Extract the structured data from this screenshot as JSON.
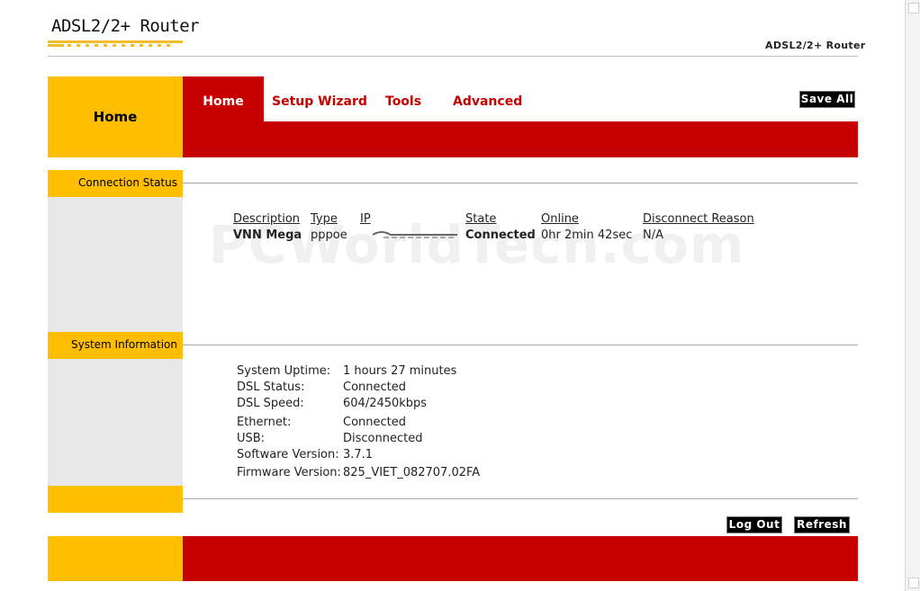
{
  "header": {
    "logo_text": "ADSL2/2+ Router",
    "product_name": "ADSL2/2+ Router"
  },
  "nav": {
    "section_title": "Home",
    "tabs": [
      "Home",
      "Setup Wizard",
      "Tools",
      "Advanced"
    ],
    "active_tab": "Home",
    "save_all_label": "Save All"
  },
  "sidebar": {
    "connection_status_label": "Connection Status",
    "system_information_label": "System Information"
  },
  "connection_status": {
    "columns": [
      "Description",
      "Type",
      "IP",
      "State",
      "Online",
      "Disconnect Reason"
    ],
    "rows": [
      {
        "description": "VNN Mega",
        "type": "pppoe",
        "state": "Connected",
        "online": "0hr 2min 42sec",
        "disconnect_reason": "N/A"
      }
    ]
  },
  "system_info": {
    "rows": [
      {
        "label": "System Uptime:",
        "value": "1 hours 27 minutes"
      },
      {
        "label": "DSL Status:",
        "value": "Connected"
      },
      {
        "label": "DSL Speed:",
        "value": "604/2450kbps"
      },
      {
        "label": "Ethernet:",
        "value": "Connected"
      },
      {
        "label": "USB:",
        "value": "Disconnected"
      },
      {
        "label": "Software Version:",
        "value": "3.7.1"
      },
      {
        "label": "Firmware Version:",
        "value": "825_VIET_082707.02FA"
      }
    ]
  },
  "footer": {
    "logout_label": "Log Out",
    "refresh_label": "Refresh"
  },
  "watermark": "PCWorldTech.com",
  "colors": {
    "brand_red": "#c60000",
    "brand_yellow": "#ffbe00",
    "sidebar_gray": "#e8e8e8"
  }
}
